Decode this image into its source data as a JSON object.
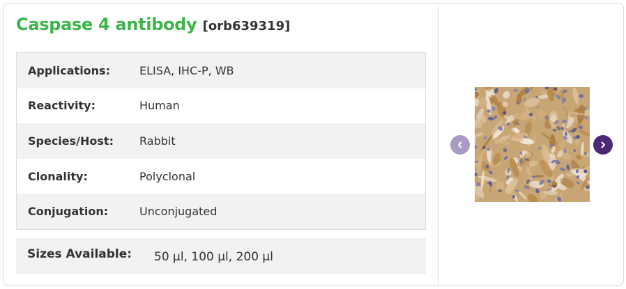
{
  "product": {
    "name": "Caspase 4 antibody",
    "catalog": "[orb639319]"
  },
  "specs": [
    {
      "label": "Applications:",
      "value": "ELISA,  IHC-P,  WB"
    },
    {
      "label": "Reactivity:",
      "value": "Human"
    },
    {
      "label": "Species/Host:",
      "value": "Rabbit"
    },
    {
      "label": "Clonality:",
      "value": "Polyclonal"
    },
    {
      "label": "Conjugation:",
      "value": "Unconjugated"
    }
  ],
  "sizes": {
    "label": "Sizes Available:",
    "value": "50 µl, 100 µl, 200 µl"
  },
  "carousel": {
    "prev_icon": "chevron-left-icon",
    "next_icon": "chevron-right-icon",
    "image": "ihc-tissue-stain-image"
  },
  "colors": {
    "title_green": "#3cb44a",
    "prev_button": "#a99bc6",
    "next_button": "#4b2979",
    "row_alt": "#f2f2f2",
    "border": "#dcdcdc"
  }
}
